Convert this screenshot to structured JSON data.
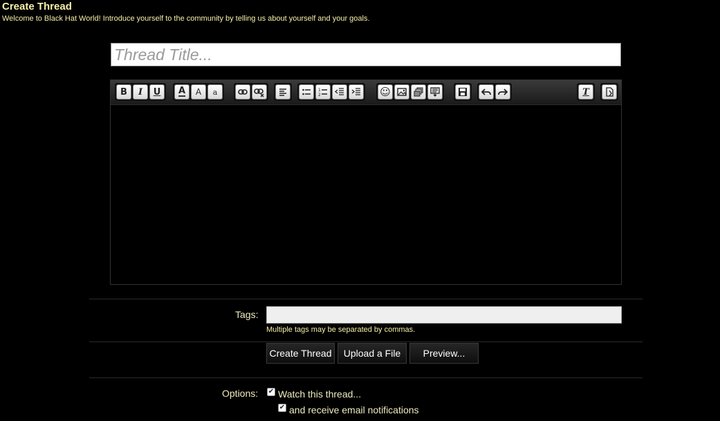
{
  "header": {
    "title": "Create Thread",
    "subtitle": "Welcome to Black Hat World! Introduce yourself to the community by telling us about yourself and your goals."
  },
  "thread_title": {
    "placeholder": "Thread Title...",
    "value": ""
  },
  "toolbar": {
    "groups": [
      [
        {
          "name": "bold-button",
          "icon": "bold-icon",
          "glyph": "B"
        },
        {
          "name": "italic-button",
          "icon": "italic-icon",
          "glyph": "I"
        },
        {
          "name": "underline-button",
          "icon": "underline-icon",
          "glyph": "U"
        }
      ],
      [
        {
          "name": "font-color-button",
          "icon": "font-color-icon",
          "glyph": "A"
        },
        {
          "name": "font-size-button",
          "icon": "font-size-icon",
          "glyph": "A"
        },
        {
          "name": "font-family-button",
          "icon": "font-family-icon",
          "glyph": "a"
        }
      ],
      [
        {
          "name": "link-button",
          "icon": "link-icon"
        },
        {
          "name": "unlink-button",
          "icon": "unlink-icon"
        }
      ],
      [
        {
          "name": "align-button",
          "icon": "align-left-icon"
        }
      ],
      [
        {
          "name": "bullet-list-button",
          "icon": "bullet-list-icon"
        },
        {
          "name": "numbered-list-button",
          "icon": "numbered-list-icon"
        },
        {
          "name": "outdent-button",
          "icon": "outdent-icon"
        },
        {
          "name": "indent-button",
          "icon": "indent-icon"
        }
      ],
      [
        {
          "name": "smilies-button",
          "icon": "smiley-icon",
          "glyph": "☺"
        },
        {
          "name": "image-button",
          "icon": "image-icon"
        },
        {
          "name": "media-button",
          "icon": "media-icon"
        },
        {
          "name": "insert-button",
          "icon": "insert-icon"
        }
      ],
      [
        {
          "name": "save-draft-button",
          "icon": "save-icon"
        }
      ],
      [
        {
          "name": "undo-button",
          "icon": "undo-icon"
        },
        {
          "name": "redo-button",
          "icon": "redo-icon"
        }
      ]
    ],
    "right_groups": [
      [
        {
          "name": "remove-format-button",
          "icon": "remove-format-icon",
          "glyph": "T"
        }
      ],
      [
        {
          "name": "toggle-bbcode-button",
          "icon": "toggle-bbcode-icon"
        }
      ]
    ]
  },
  "tags": {
    "label": "Tags:",
    "value": "",
    "hint": "Multiple tags may be separated by commas."
  },
  "buttons": {
    "create_thread": "Create Thread",
    "upload_file": "Upload a File",
    "preview": "Preview..."
  },
  "options": {
    "label": "Options:",
    "watch_thread": {
      "label": "Watch this thread...",
      "checked": true
    },
    "email_notifications": {
      "label": "and receive email notifications",
      "checked": true
    }
  }
}
